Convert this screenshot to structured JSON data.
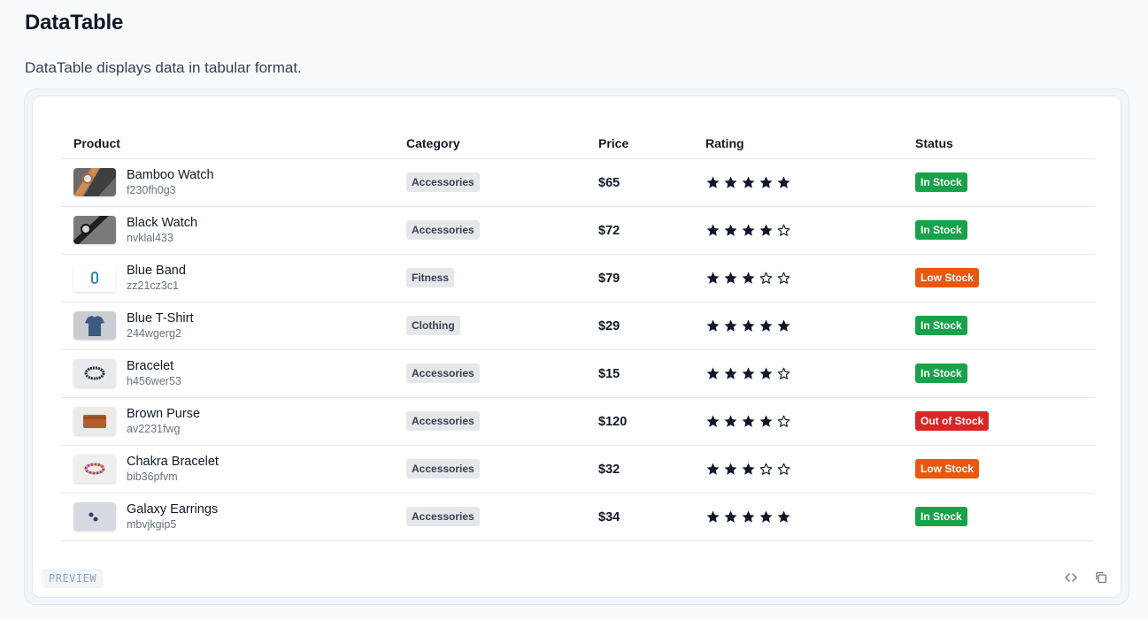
{
  "page": {
    "title": "DataTable",
    "description": "DataTable displays data in tabular format."
  },
  "table": {
    "columns": [
      "Product",
      "Category",
      "Price",
      "Rating",
      "Status"
    ],
    "rows": [
      {
        "name": "Bamboo Watch",
        "code": "f230fh0g3",
        "category": "Accessories",
        "price": "$65",
        "rating": 5,
        "status": "In Stock",
        "thumb": "bamboo-watch-thumb"
      },
      {
        "name": "Black Watch",
        "code": "nvklal433",
        "category": "Accessories",
        "price": "$72",
        "rating": 4,
        "status": "In Stock",
        "thumb": "black-watch-thumb"
      },
      {
        "name": "Blue Band",
        "code": "zz21cz3c1",
        "category": "Fitness",
        "price": "$79",
        "rating": 3,
        "status": "Low Stock",
        "thumb": "blue-band-thumb"
      },
      {
        "name": "Blue T-Shirt",
        "code": "244wgerg2",
        "category": "Clothing",
        "price": "$29",
        "rating": 5,
        "status": "In Stock",
        "thumb": "blue-tshirt-thumb"
      },
      {
        "name": "Bracelet",
        "code": "h456wer53",
        "category": "Accessories",
        "price": "$15",
        "rating": 4,
        "status": "In Stock",
        "thumb": "bracelet-thumb"
      },
      {
        "name": "Brown Purse",
        "code": "av2231fwg",
        "category": "Accessories",
        "price": "$120",
        "rating": 4,
        "status": "Out of Stock",
        "thumb": "brown-purse-thumb"
      },
      {
        "name": "Chakra Bracelet",
        "code": "bib36pfvm",
        "category": "Accessories",
        "price": "$32",
        "rating": 3,
        "status": "Low Stock",
        "thumb": "chakra-bracelet-thumb"
      },
      {
        "name": "Galaxy Earrings",
        "code": "mbvjkgip5",
        "category": "Accessories",
        "price": "$34",
        "rating": 5,
        "status": "In Stock",
        "thumb": "galaxy-earrings-thumb"
      }
    ],
    "max_rating": 5
  },
  "status_colors": {
    "In Stock": "#16a34a",
    "Low Stock": "#ea580c",
    "Out of Stock": "#dc2626"
  },
  "footer": {
    "preview_label": "PREVIEW",
    "code_icon": "code-icon",
    "copy_icon": "copy-icon"
  }
}
